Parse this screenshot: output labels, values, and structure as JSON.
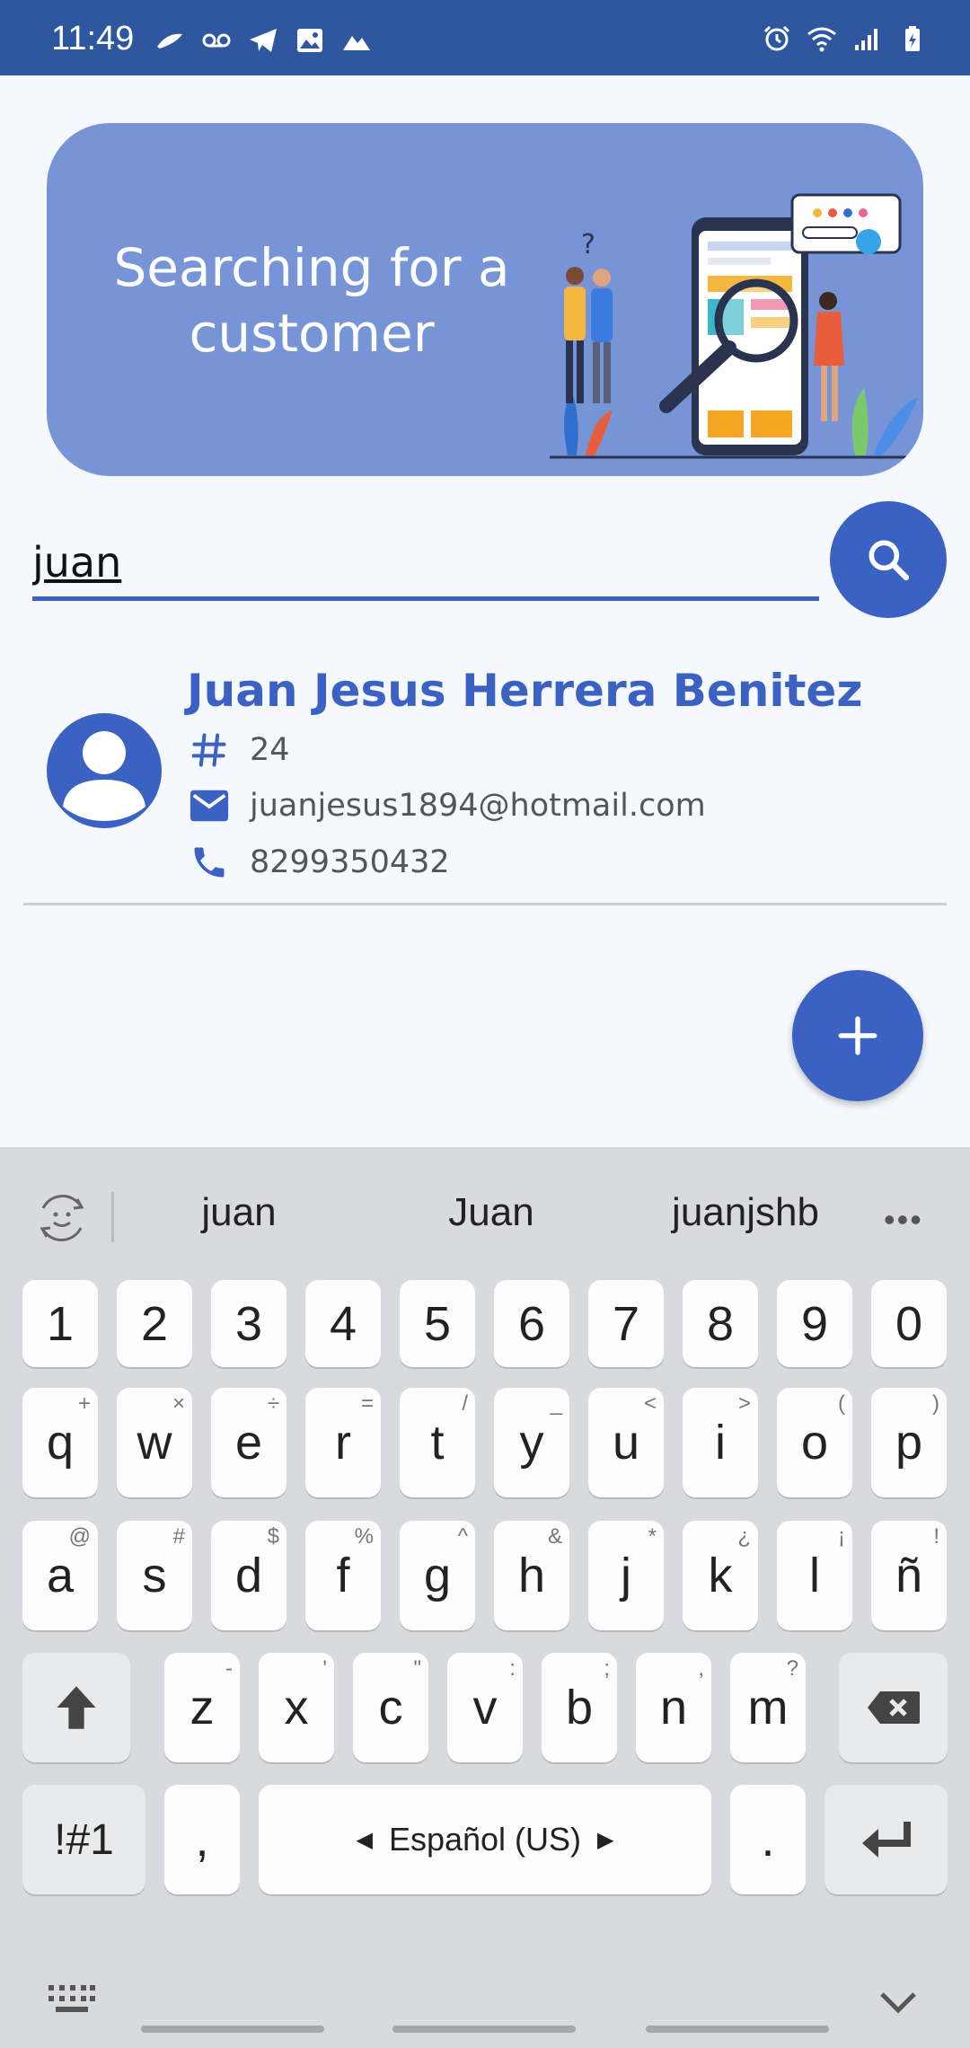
{
  "status_bar": {
    "time": "11:49",
    "left_icons": [
      "notification-icon",
      "voicemail-icon",
      "telegram-icon",
      "image-icon",
      "mountain-icon"
    ],
    "right_icons": [
      "alarm-icon",
      "wifi-icon",
      "signal-icon",
      "battery-icon"
    ]
  },
  "banner": {
    "title": "Searching for a customer",
    "illustration": "search-illustration"
  },
  "search": {
    "value": "juan",
    "button_icon": "search-icon"
  },
  "customer": {
    "name": "Juan Jesus Herrera Benitez",
    "id": "24",
    "email": "juanjesus1894@hotmail.com",
    "phone": "8299350432"
  },
  "fab": {
    "icon": "plus-icon"
  },
  "keyboard": {
    "suggestions": [
      "juan",
      "Juan",
      "juanjshb"
    ],
    "more": "•••",
    "number_row": [
      "1",
      "2",
      "3",
      "4",
      "5",
      "6",
      "7",
      "8",
      "9",
      "0"
    ],
    "row1": [
      {
        "k": "q",
        "h": "+"
      },
      {
        "k": "w",
        "h": "×"
      },
      {
        "k": "e",
        "h": "÷"
      },
      {
        "k": "r",
        "h": "="
      },
      {
        "k": "t",
        "h": "/"
      },
      {
        "k": "y",
        "h": "_"
      },
      {
        "k": "u",
        "h": "<"
      },
      {
        "k": "i",
        "h": ">"
      },
      {
        "k": "o",
        "h": "("
      },
      {
        "k": "p",
        "h": ")"
      }
    ],
    "row2": [
      {
        "k": "a",
        "h": "@"
      },
      {
        "k": "s",
        "h": "#"
      },
      {
        "k": "d",
        "h": "$"
      },
      {
        "k": "f",
        "h": "%"
      },
      {
        "k": "g",
        "h": "^"
      },
      {
        "k": "h",
        "h": "&"
      },
      {
        "k": "j",
        "h": "*"
      },
      {
        "k": "k",
        "h": "¿"
      },
      {
        "k": "l",
        "h": "¡"
      },
      {
        "k": "ñ",
        "h": "!"
      }
    ],
    "row3": [
      {
        "k": "z",
        "h": "-"
      },
      {
        "k": "x",
        "h": "'"
      },
      {
        "k": "c",
        "h": "\""
      },
      {
        "k": "v",
        "h": ":"
      },
      {
        "k": "b",
        "h": ";"
      },
      {
        "k": "n",
        "h": ","
      },
      {
        "k": "m",
        "h": "?"
      }
    ],
    "symbols_label": "!#1",
    "comma": ",",
    "space_label": "Español (US)",
    "period": "."
  }
}
